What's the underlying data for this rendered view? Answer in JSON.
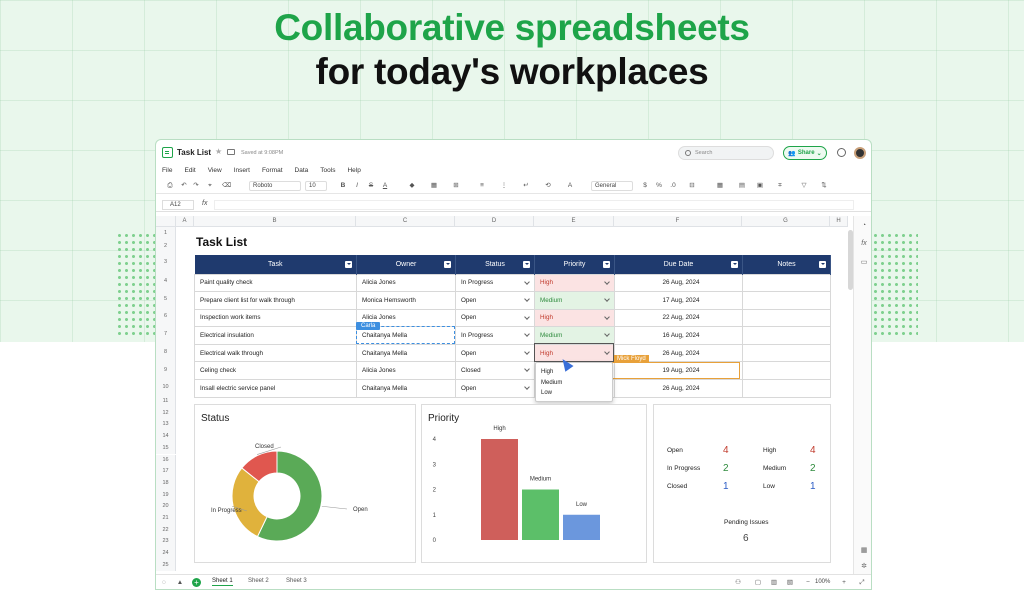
{
  "headline": {
    "line1": "Collaborative spreadsheets",
    "line2": "for today's workplaces"
  },
  "app": {
    "doc_title": "Task List",
    "saved_text": "Saved at 9:08PM",
    "search_placeholder": "Search",
    "share_label": "Share",
    "menu": [
      "File",
      "Edit",
      "View",
      "Insert",
      "Format",
      "Data",
      "Tools",
      "Help"
    ],
    "font_name": "Roboto",
    "font_size": "10",
    "number_format": "General",
    "cell_ref": "A12",
    "fx_label": "fx",
    "columns": [
      "A",
      "B",
      "C",
      "D",
      "E",
      "F",
      "G",
      "H"
    ],
    "rows": [
      "1",
      "2",
      "3",
      "4",
      "5",
      "6",
      "7",
      "8",
      "9",
      "10",
      "11",
      "12",
      "13",
      "14",
      "15",
      "16",
      "17",
      "18",
      "19",
      "20",
      "21",
      "22",
      "23",
      "24",
      "25",
      "26",
      "27",
      "28",
      "29"
    ],
    "zoom": "100%"
  },
  "sheet": {
    "title": "Task List",
    "headers": [
      "Task",
      "Owner",
      "Status",
      "Priority",
      "Due Date",
      "Notes"
    ],
    "rows": [
      {
        "task": "Paint quality check",
        "owner": "Alicia Jones",
        "status": "In Progress",
        "priority": "High",
        "due": "26 Aug, 2024"
      },
      {
        "task": "Prepare client list for walk through",
        "owner": "Monica Hemsworth",
        "status": "Open",
        "priority": "Medium",
        "due": "17 Aug, 2024"
      },
      {
        "task": "Inspection work items",
        "owner": "Alicia Jones",
        "status": "Open",
        "priority": "High",
        "due": "22 Aug, 2024"
      },
      {
        "task": "Electrical insulation",
        "owner": "Chaitanya Mella",
        "status": "In Progress",
        "priority": "Medium",
        "due": "16 Aug, 2024"
      },
      {
        "task": "Electrical walk through",
        "owner": "Chaitanya Mella",
        "status": "Open",
        "priority": "High",
        "due": "26 Aug, 2024"
      },
      {
        "task": "Celing check",
        "owner": "Alicia Jones",
        "status": "Closed",
        "priority": "",
        "due": "19 Aug, 2024"
      },
      {
        "task": "Insall electric service panel",
        "owner": "Chaitanya Mella",
        "status": "Open",
        "priority": "",
        "due": "26 Aug, 2024"
      }
    ],
    "collaborators": {
      "carla": "Carla",
      "mick": "Mick Floyd"
    },
    "dropdown_options": [
      "High",
      "Medium",
      "Low"
    ]
  },
  "chart_data": [
    {
      "type": "pie",
      "title": "Status",
      "categories": [
        "Open",
        "In Progress",
        "Closed"
      ],
      "values": [
        4,
        2,
        1
      ],
      "colors": [
        "#5aaa57",
        "#e0b23c",
        "#e0574f"
      ]
    },
    {
      "type": "bar",
      "title": "Priority",
      "categories": [
        "High",
        "Medium",
        "Low"
      ],
      "values": [
        4,
        2,
        1
      ],
      "colors": [
        "#cf5f5b",
        "#5cbf69",
        "#6b97dd"
      ],
      "ylim": [
        0,
        4
      ],
      "yticks": [
        "0",
        "1",
        "2",
        "3",
        "4"
      ]
    }
  ],
  "summary": {
    "status": [
      {
        "label": "Open",
        "value": "4",
        "color": "#c0392b"
      },
      {
        "label": "In Progress",
        "value": "2",
        "color": "#2e8b3d"
      },
      {
        "label": "Closed",
        "value": "1",
        "color": "#2c5cc5"
      }
    ],
    "priority": [
      {
        "label": "High",
        "value": "4",
        "color": "#c0392b"
      },
      {
        "label": "Medium",
        "value": "2",
        "color": "#2e8b3d"
      },
      {
        "label": "Low",
        "value": "1",
        "color": "#2c5cc5"
      }
    ],
    "pending_label": "Pending Issues",
    "pending_value": "6"
  },
  "tabs": [
    "Sheet 1",
    "Sheet 2",
    "Sheet 3"
  ]
}
